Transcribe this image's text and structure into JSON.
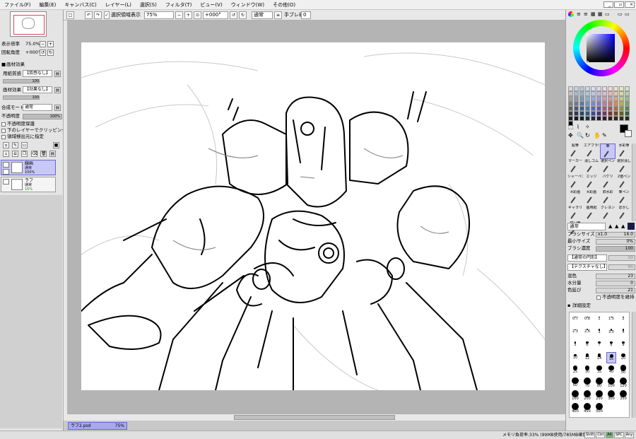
{
  "menu": [
    "ファイル(F)",
    "編集(E)",
    "キャンバス(C)",
    "レイヤー(L)",
    "選択(S)",
    "フィルタ(T)",
    "ビュー(V)",
    "ウィンドウ(W)",
    "その他(O)"
  ],
  "toolbar": {
    "show_selection_label": "選択領域表示",
    "zoom_value": "75%",
    "rotation_value": "+000°",
    "blend_value": "通常",
    "stabilizer_label": "手ブレ補正",
    "stabilizer_value": "0"
  },
  "navigator": {
    "zoom_label": "表示倍率",
    "zoom_value": "75.0%",
    "angle_label": "回転角度",
    "angle_value": "+000°"
  },
  "material": {
    "section_label": "画材効果",
    "paper_label": "用紙質感",
    "paper_value": "【質感なし】",
    "paper_level": "100",
    "effect_label": "画材効果",
    "effect_value": "【効果なし】",
    "effect_level": "100"
  },
  "blend": {
    "mode_label": "合成モード",
    "mode_value": "通常",
    "opacity_label": "不透明度",
    "opacity_value": "100%",
    "protect_opacity": "不透明度保護",
    "clip_lower": "下のレイヤーでクリッピング",
    "selection_source": "領域検出元に指定"
  },
  "layers": [
    {
      "name": "線画",
      "mode": "通常",
      "opacity": "100%",
      "selected": true
    },
    {
      "name": "ラフ",
      "mode": "通常",
      "opacity": "16%",
      "selected": false
    }
  ],
  "tab": {
    "file": "ラフ2.psd",
    "zoom": "75%"
  },
  "status": {
    "memory": "メモリ負荷率:33% (99MB使用/785MB確保)",
    "indicators": [
      "Shift",
      "Ctrl",
      "Alt",
      "SPC",
      "Any"
    ]
  },
  "swatch_colors": [
    "#d8d8d8",
    "#c8d0d8",
    "#b8c8d8",
    "#c8d8e8",
    "#d8e0f0",
    "#e0d8e8",
    "#e8d8e0",
    "#f0d8d8",
    "#f0e0c8",
    "#e8e8c8",
    "#d0e0c8",
    "#c0c0c0",
    "#a8b8c8",
    "#98b0c8",
    "#a8c8e0",
    "#b8c8f0",
    "#c8b8e0",
    "#e0b8d0",
    "#e8b8b8",
    "#e8c8a0",
    "#d8d8a0",
    "#b0d0a0",
    "#a0a0a0",
    "#8898b0",
    "#7898b8",
    "#88b0d0",
    "#98a8e0",
    "#a898d0",
    "#d098b8",
    "#d89898",
    "#d8a878",
    "#c8c878",
    "#90c088",
    "#808080",
    "#687898",
    "#5878a0",
    "#6898c0",
    "#7888d0",
    "#8878c0",
    "#c078a0",
    "#c07878",
    "#c89058",
    "#b0b058",
    "#70a868",
    "#606060",
    "#485878",
    "#386088",
    "#4878a8",
    "#5868b8",
    "#6858a8",
    "#a05888",
    "#a05858",
    "#a87040",
    "#909040",
    "#508850",
    "#404040",
    "#303850",
    "#284868",
    "#305880",
    "#404890",
    "#483878",
    "#703860",
    "#703838",
    "#704820",
    "#606020",
    "#386038",
    "#202020",
    "#101820",
    "#102030",
    "#183040",
    "#202840",
    "#281838",
    "#381828",
    "#381818",
    "#382410",
    "#303010",
    "#183018",
    "#000000"
  ],
  "tools": [
    {
      "label": "鉛筆",
      "sel": false
    },
    {
      "label": "エアブラシ",
      "sel": false
    },
    {
      "label": "筆",
      "sel": true
    },
    {
      "label": "水彩筆",
      "sel": false
    },
    {
      "label": "マーカー",
      "sel": false
    },
    {
      "label": "消しゴム",
      "sel": false
    },
    {
      "label": "選択ペン",
      "sel": false
    },
    {
      "label": "選択消し",
      "sel": false
    },
    {
      "label": "シャーペン",
      "sel": false
    },
    {
      "label": "エッジ",
      "sel": false
    },
    {
      "label": "バケツ",
      "sel": false
    },
    {
      "label": "2値ペン",
      "sel": false
    },
    {
      "label": "※彩画",
      "sel": false
    },
    {
      "label": "※彩画",
      "sel": false
    },
    {
      "label": "旧水彩",
      "sel": false
    },
    {
      "label": "筆ペン",
      "sel": false
    },
    {
      "label": "ギャラリ",
      "sel": false
    },
    {
      "label": "画用紙",
      "sel": false
    },
    {
      "label": "クレヨン",
      "sel": false
    },
    {
      "label": "ぼかし",
      "sel": false
    },
    {
      "label": "鋭い筆",
      "sel": false
    }
  ],
  "brush": {
    "mode_value": "通常",
    "size_label": "ブラシサイズ",
    "size_mult": "x1.0",
    "size_value": "16.0",
    "min_size_label": "最小サイズ",
    "min_size_value": "0%",
    "density_label": "ブラシ濃度",
    "density_value": "100",
    "shape_value": "【通常の円形】",
    "shape_level": "50",
    "texture_value": "【テクスチャなし】",
    "texture_level": "95",
    "mix_label": "混色",
    "mix_value": "23",
    "water_label": "水分量",
    "water_value": "0",
    "blur_label": "色延び",
    "blur_value": "21",
    "keep_opacity": "不透明度を維持",
    "detail_label": "詳細設定"
  },
  "brush_sizes": [
    "0.7",
    "0.8",
    "1",
    "1.5",
    "2",
    "2.3",
    "2.6",
    "3",
    "3.5",
    "4",
    "5",
    "6",
    "7",
    "8",
    "9",
    "10",
    "12",
    "14",
    "16",
    "20",
    "25",
    "30",
    "35",
    "40",
    "50",
    "60",
    "70",
    "80",
    "100",
    "120",
    "160",
    "200",
    "250",
    "300",
    "350",
    "400",
    "450",
    "500"
  ]
}
